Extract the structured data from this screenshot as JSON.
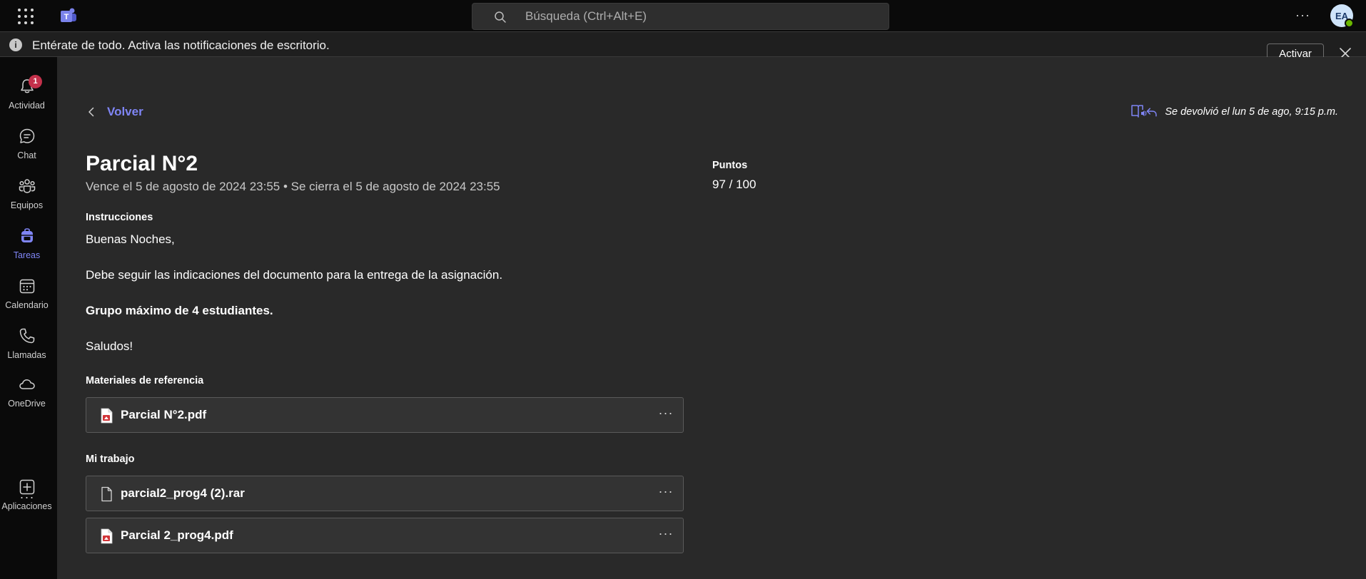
{
  "topbar": {
    "search_placeholder": "Búsqueda (Ctrl+Alt+E)",
    "more_label": "···",
    "avatar_initials": "EA"
  },
  "notification": {
    "info_symbol": "i",
    "text": "Entérate de todo. Activa las notificaciones de escritorio.",
    "activate_label": "Activar"
  },
  "rail": {
    "badge_count": "1",
    "items": [
      {
        "label": "Actividad",
        "icon": "bell-icon"
      },
      {
        "label": "Chat",
        "icon": "chat-icon"
      },
      {
        "label": "Equipos",
        "icon": "teams-icon"
      },
      {
        "label": "Tareas",
        "icon": "backpack-icon"
      },
      {
        "label": "Calendario",
        "icon": "calendar-icon"
      },
      {
        "label": "Llamadas",
        "icon": "phone-icon"
      },
      {
        "label": "OneDrive",
        "icon": "cloud-icon"
      },
      {
        "label": "Aplicaciones",
        "icon": "add-app-icon"
      }
    ],
    "more_label": "···"
  },
  "header": {
    "back_label": "Volver",
    "returned_text": "Se devolvió el lun 5 de ago, 9:15 p.m."
  },
  "assignment": {
    "title": "Parcial N°2",
    "due_line": "Vence el 5 de agosto de 2024 23:55 • Se cierra el 5 de agosto de 2024 23:55",
    "instructions_heading": "Instrucciones",
    "instructions": [
      "Buenas Noches,",
      "Debe seguir las indicaciones del documento para la entrega de la asignación.",
      "Grupo máximo de 4 estudiantes.",
      "Saludos!"
    ],
    "points_heading": "Puntos",
    "points_value": "97 / 100"
  },
  "reference": {
    "heading": "Materiales de referencia",
    "files": [
      {
        "name": "Parcial N°2.pdf",
        "type": "pdf"
      }
    ]
  },
  "work": {
    "heading": "Mi trabajo",
    "files": [
      {
        "name": "parcial2_prog4 (2).rar",
        "type": "generic"
      },
      {
        "name": "Parcial 2_prog4.pdf",
        "type": "pdf"
      }
    ]
  },
  "file_more_label": "···",
  "colors": {
    "accent": "#7f85f5",
    "background": "#292929",
    "rail_background": "#0a0a0a",
    "badge": "#c4314b",
    "presence": "#6bb700",
    "pdf_red": "#d13438"
  }
}
